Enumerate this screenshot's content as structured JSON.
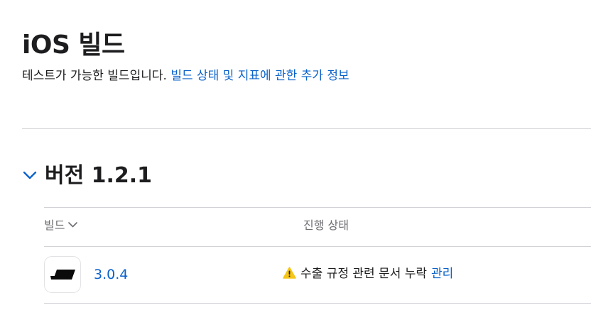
{
  "page": {
    "title": "iOS 빌드",
    "description": "테스트가 가능한 빌드입니다.",
    "info_link": "빌드 상태 및 지표에 관한 추가 정보"
  },
  "version_group": {
    "label": "버전 1.2.1",
    "expanded": true
  },
  "table": {
    "columns": {
      "build": "빌드",
      "status": "진행 상태"
    },
    "rows": [
      {
        "build": "3.0.4",
        "status": "수출 규정 관련 문서 누락",
        "action": "관리"
      }
    ]
  },
  "colors": {
    "link": "#0a62c9",
    "warning": "#f5c518",
    "divider": "#d2d2d7",
    "muted_text": "#6e6e73"
  },
  "icons": {
    "expand": "chevron-down-icon",
    "sort": "chevron-down-icon",
    "warning": "warning-triangle-icon",
    "app": "app-icon"
  }
}
